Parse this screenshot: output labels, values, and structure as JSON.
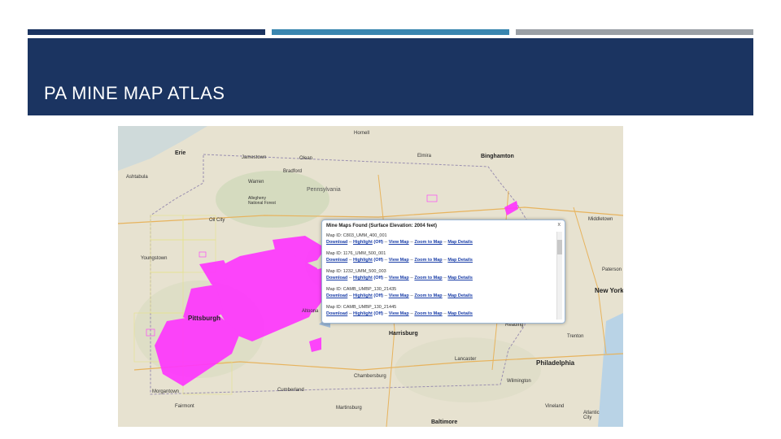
{
  "slide": {
    "title": "PA MINE MAP ATLAS"
  },
  "colors": {
    "band": "#1b3461",
    "accent_blue": "#3a86b0",
    "accent_gray": "#9aa0a6",
    "mine_overlay": "#ff33ff",
    "link": "#1a3ea8"
  },
  "map": {
    "places": {
      "hornell": "Hornell",
      "erie": "Erie",
      "jamestown": "Jamestown",
      "olean": "Olean",
      "elmira": "Elmira",
      "binghamton": "Binghamton",
      "ashtabula": "Ashtabula",
      "bradford": "Bradford",
      "warren": "Warren",
      "allegheny": "Allegheny National Forest",
      "pennsylvania": "Pennsylvania",
      "oil_city": "Oil City",
      "youngstown": "Youngstown",
      "pittsburgh": "Pittsburgh",
      "altoona": "Altoona",
      "harrisburg": "Harrisburg",
      "reading": "Reading",
      "lancaster": "Lancaster",
      "chambersburg": "Chambersburg",
      "philadelphia": "Philadelphia",
      "trenton": "Trenton",
      "new_york": "New York",
      "paterson": "Paterson",
      "middletown": "Middletown",
      "wilmington": "Wilmington",
      "baltimore": "Baltimore",
      "vineland": "Vineland",
      "atlantic_city": "Atlantic City",
      "morgantown": "Morgantown",
      "fairmont": "Fairmont",
      "cumberland": "Cumberland",
      "martinsburg": "Martinsburg"
    },
    "popup": {
      "title": "Mine Maps Found (Surface Elevation: 2004 feet)",
      "close": "x",
      "link_download": "Download",
      "link_highlight": "Highlight",
      "highlight_state": "(Off)",
      "link_view": "View Map",
      "link_zoom": "Zoom to Map",
      "link_details": "Map Details",
      "separator": "--",
      "entries": [
        {
          "id": "Map ID: C803_UMM_400_001"
        },
        {
          "id": "Map ID: 1176_UMM_500_001"
        },
        {
          "id": "Map ID: 1232_UMM_500_003"
        },
        {
          "id": "Map ID: CAMB_UMBP_130_21435"
        },
        {
          "id": "Map ID: CAMB_UMBP_130_21445"
        }
      ]
    }
  }
}
